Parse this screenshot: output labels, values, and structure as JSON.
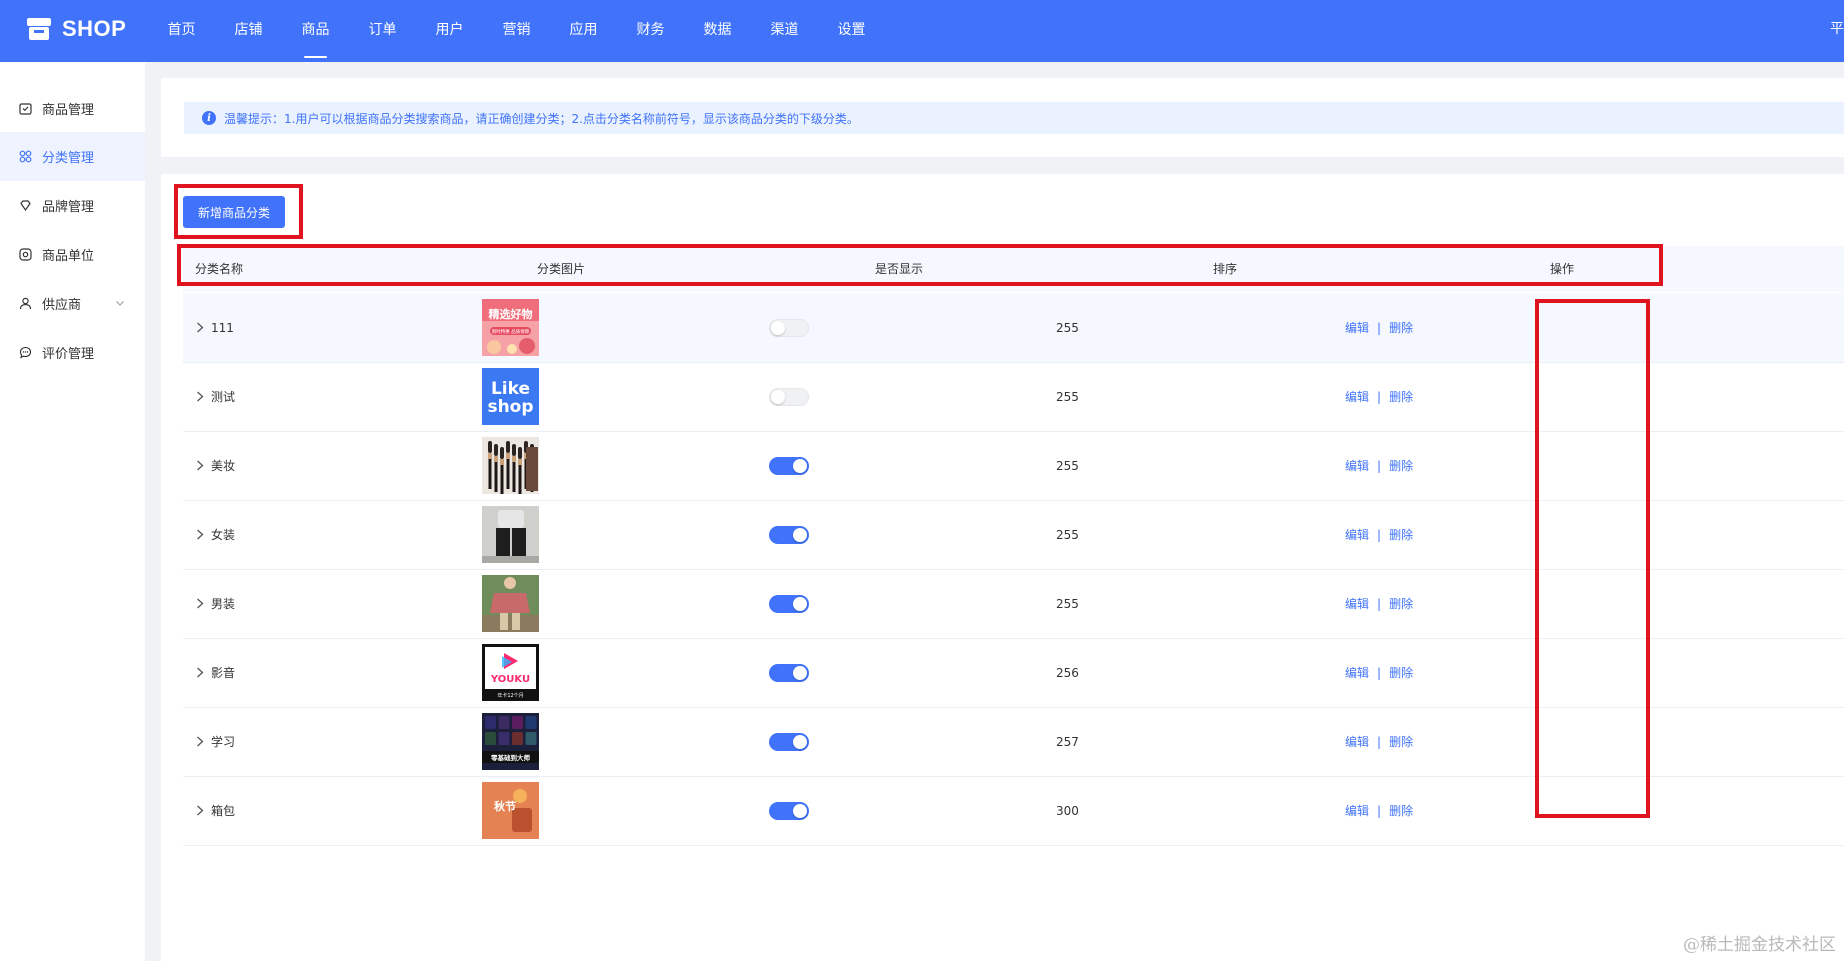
{
  "brand": {
    "name": "SHOP"
  },
  "nav": {
    "items": [
      "首页",
      "店铺",
      "商品",
      "订单",
      "用户",
      "营销",
      "应用",
      "财务",
      "数据",
      "渠道",
      "设置"
    ],
    "active_index": 2,
    "right_text": "平"
  },
  "sidebar": {
    "items": [
      {
        "label": "商品管理",
        "icon": "calendar-icon"
      },
      {
        "label": "分类管理",
        "icon": "category-grid-icon"
      },
      {
        "label": "品牌管理",
        "icon": "diamond-icon"
      },
      {
        "label": "商品单位",
        "icon": "circle-target-icon"
      },
      {
        "label": "供应商",
        "icon": "user-icon"
      },
      {
        "label": "评价管理",
        "icon": "chat-bubble-icon"
      }
    ],
    "active_index": 1
  },
  "tip": {
    "text": "温馨提示：1.用户可以根据商品分类搜索商品，请正确创建分类；2.点击分类名称前符号，显示该商品分类的下级分类。"
  },
  "toolbar": {
    "add_label": "新增商品分类"
  },
  "table": {
    "headers": {
      "name": "分类名称",
      "image": "分类图片",
      "visible": "是否显示",
      "sort": "排序",
      "actions": "操作"
    },
    "edit_label": "编辑",
    "delete_label": "删除",
    "separator": "|",
    "rows": [
      {
        "name": "111",
        "image": "promo-thumbnail",
        "visible": false,
        "sort": "255"
      },
      {
        "name": "测试",
        "image": "likeshop-thumbnail",
        "visible": false,
        "sort": "255"
      },
      {
        "name": "美妆",
        "image": "makeup-brushes-thumbnail",
        "visible": true,
        "sort": "255"
      },
      {
        "name": "女装",
        "image": "womens-clothing-thumbnail",
        "visible": true,
        "sort": "255"
      },
      {
        "name": "男装",
        "image": "mens-clothing-thumbnail",
        "visible": true,
        "sort": "255"
      },
      {
        "name": "影音",
        "image": "youku-thumbnail",
        "visible": true,
        "sort": "256"
      },
      {
        "name": "学习",
        "image": "software-course-thumbnail",
        "visible": true,
        "sort": "257"
      },
      {
        "name": "箱包",
        "image": "bags-thumbnail",
        "visible": true,
        "sort": "300"
      }
    ]
  },
  "thumb_text": {
    "promo": "精选好物",
    "promo_sub": "限时特惠 品质保障",
    "likeshop_line1": "Like",
    "likeshop_line2": "shop",
    "youku": "YOUKU",
    "youku_sub": "年卡12个月",
    "course": "零基础到大师",
    "bags": "秋节"
  },
  "colors": {
    "primary": "#4073fa",
    "highlight_box": "#e0141e"
  },
  "watermark": "@稀土掘金技术社区"
}
